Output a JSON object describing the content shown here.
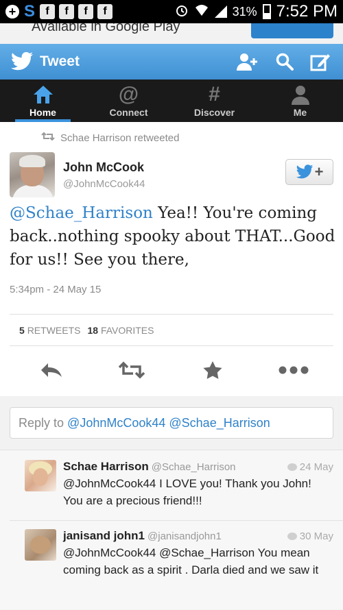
{
  "status_bar": {
    "battery": "31%",
    "time": "7:52 PM",
    "left_icons": [
      "plus-icon",
      "s-app-icon",
      "facebook-icon",
      "facebook-icon",
      "facebook-icon",
      "facebook-icon"
    ]
  },
  "banner": {
    "text": "Available in Google Play"
  },
  "topbar": {
    "title": "Tweet",
    "color": "#4a9de0"
  },
  "tabs": [
    {
      "label": "Home",
      "icon": "home-icon",
      "active": true
    },
    {
      "label": "Connect",
      "icon": "at-icon"
    },
    {
      "label": "Discover",
      "icon": "hashtag-icon"
    },
    {
      "label": "Me",
      "icon": "person-icon"
    }
  ],
  "tab_glyphs": {
    "connect": "@",
    "discover": "#"
  },
  "tweet": {
    "retweeted_by": "Schae Harrison retweeted",
    "name": "John McCook",
    "handle": "@JohnMcCook44",
    "mention": "@Schae_Harrison",
    "text": " Yea!! You're coming back..nothing spooky about THAT...Good for us!! See you there,",
    "timestamp": "5:34pm - 24 May 15",
    "retweets_count": "5",
    "retweets_label": "RETWEETS",
    "favorites_count": "18",
    "favorites_label": "FAVORITES",
    "follow_plus": "+"
  },
  "reply_box": {
    "prefix": "Reply to ",
    "mentions": "@JohnMcCook44 @Schae_Harrison"
  },
  "replies": [
    {
      "name": "Schae Harrison",
      "handle": "@Schae_Harrison",
      "date": "24 May",
      "text": "@JohnMcCook44 I LOVE you! Thank you John! You are a precious friend!!!"
    },
    {
      "name": "janisand john1",
      "handle": "@janisandjohn1",
      "date": "30 May",
      "text": "@JohnMcCook44 @Schae_Harrison You mean coming back as a spirit . Darla died and we saw it"
    }
  ]
}
